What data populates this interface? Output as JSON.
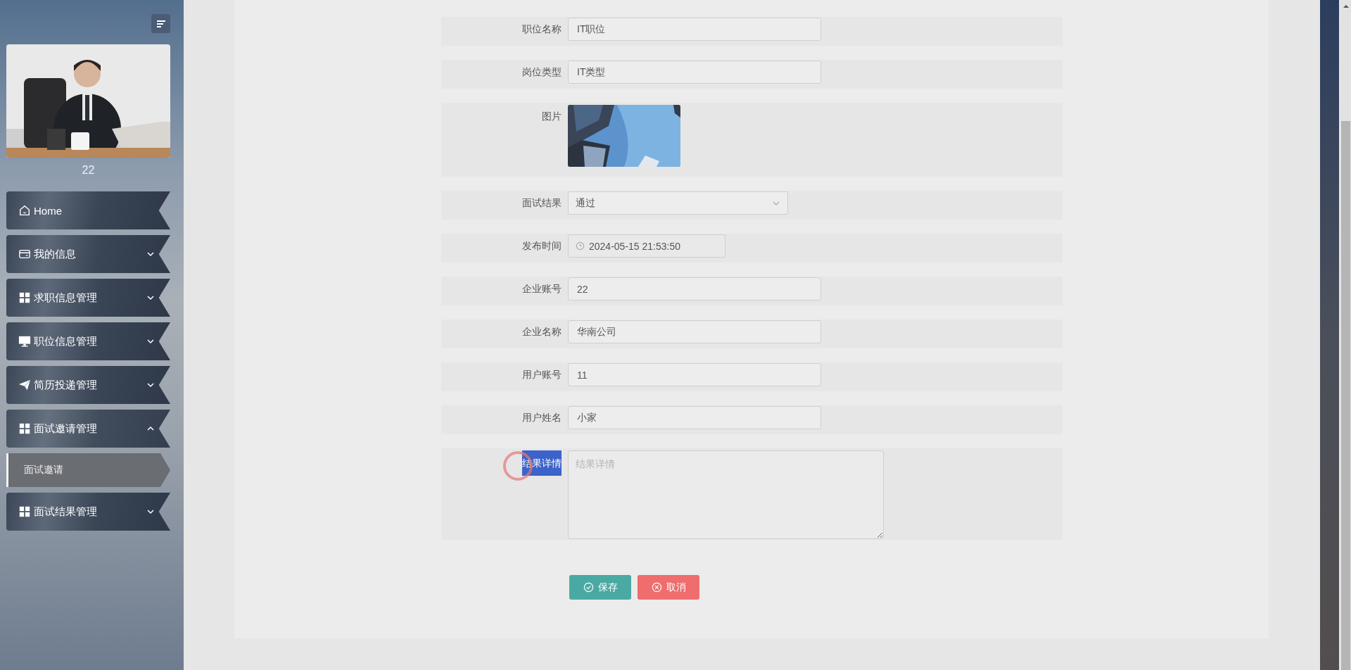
{
  "sidebar": {
    "user_name": "22",
    "menu": [
      {
        "label": "Home"
      },
      {
        "label": "我的信息",
        "expanded": false
      },
      {
        "label": "求职信息管理",
        "expanded": false
      },
      {
        "label": "职位信息管理",
        "expanded": false
      },
      {
        "label": "简历投递管理",
        "expanded": false
      },
      {
        "label": "面试邀请管理",
        "expanded": true,
        "children": [
          {
            "label": "面试邀请",
            "selected": true
          }
        ]
      },
      {
        "label": "面试结果管理",
        "expanded": false
      }
    ]
  },
  "form": {
    "fields": [
      {
        "kind": "text",
        "label": "职位名称",
        "value": "IT职位"
      },
      {
        "kind": "text",
        "label": "岗位类型",
        "value": "IT类型"
      },
      {
        "label": "图片"
      },
      {
        "kind": "select",
        "label": "面试结果",
        "value": "通过"
      },
      {
        "kind": "datetime",
        "label": "发布时间",
        "value": "2024-05-15 21:53:50"
      },
      {
        "kind": "text",
        "label": "企业账号",
        "value": "22"
      },
      {
        "kind": "text",
        "label": "企业名称",
        "value": "华南公司"
      },
      {
        "kind": "text",
        "label": "用户账号",
        "value": "11"
      },
      {
        "kind": "text",
        "label": "用户姓名",
        "value": "小家"
      },
      {
        "kind": "textarea",
        "label": "结果详情",
        "placeholder": "结果详情",
        "label_highlighted": true
      }
    ],
    "buttons": [
      {
        "kind": "save",
        "label": "保存"
      },
      {
        "kind": "cancel",
        "label": "取消"
      }
    ]
  }
}
